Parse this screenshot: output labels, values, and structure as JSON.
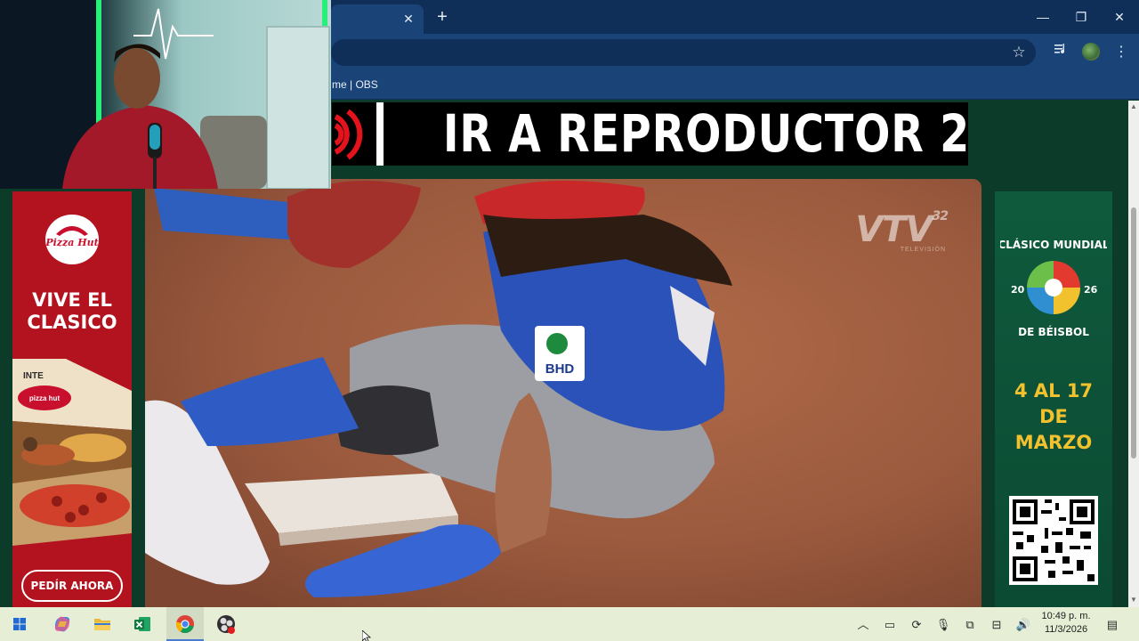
{
  "browser": {
    "tab_close_glyph": "✕",
    "new_tab_glyph": "+",
    "window": {
      "minimize": "—",
      "maximize": "❐",
      "close": "✕"
    },
    "bookmark_visible_text": "me | OBS"
  },
  "page": {
    "banner": {
      "text": "IR A REPRODUCTOR 2"
    },
    "video": {
      "watermark": "VTV",
      "watermark_number": "32",
      "watermark_sub": "TELEVISIÓN",
      "jersey_patch": "BHD"
    },
    "ad_left": {
      "brand": "Pizza Hut",
      "headline_line1": "VIVE EL",
      "headline_line2": "CLASICO",
      "box_text": "pizza hut",
      "box_edge_text": "INTE",
      "cta": "PEDÍR AHORA"
    },
    "ad_right": {
      "logo_top": "CLÁSICO MUNDIAL",
      "logo_year_left": "20",
      "logo_year_right": "26",
      "logo_bottom": "DE BÉISBOL",
      "dates_line1": "4 AL 17",
      "dates_line2": "DE",
      "dates_line3": "MARZO"
    }
  },
  "taskbar": {
    "apps": [
      "windows-start",
      "copilot",
      "file-explorer",
      "excel",
      "chrome",
      "obs"
    ],
    "active_app": "chrome",
    "clock_time": "10:49 p. m.",
    "clock_date": "11/3/2026"
  },
  "colors": {
    "chrome_dark": "#0f2f58",
    "chrome_light": "#1a4478",
    "page_green": "#0d3b29",
    "ad_red": "#b3121f",
    "ad_green": "#0f5a3d",
    "date_yellow": "#f2c12e",
    "taskbar": "#e6efd6"
  }
}
